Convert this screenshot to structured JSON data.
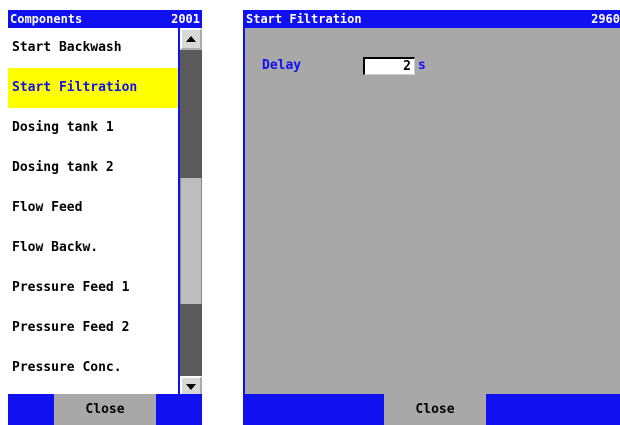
{
  "left_panel": {
    "title": "Components",
    "number": "2001",
    "items": [
      {
        "label": "Start Backwash",
        "selected": false
      },
      {
        "label": "Start Filtration",
        "selected": true
      },
      {
        "label": "Dosing tank 1",
        "selected": false
      },
      {
        "label": "Dosing tank 2",
        "selected": false
      },
      {
        "label": "Flow Feed",
        "selected": false
      },
      {
        "label": "Flow Backw.",
        "selected": false
      },
      {
        "label": "Pressure Feed 1",
        "selected": false
      },
      {
        "label": "Pressure Feed 2",
        "selected": false
      },
      {
        "label": "Pressure Conc.",
        "selected": false
      }
    ],
    "close_label": "Close"
  },
  "right_panel": {
    "title": "Start Filtration",
    "number": "2960",
    "delay_label": "Delay",
    "delay_value": "2",
    "delay_unit": "s",
    "close_label": "Close"
  },
  "colors": {
    "titlebar": "#1010f0",
    "selection": "#ffff00",
    "content_bg": "#a8a8a8",
    "button_bg": "#a8a8a8"
  },
  "icons": [
    "scroll-up-arrow-icon",
    "scroll-down-arrow-icon"
  ]
}
